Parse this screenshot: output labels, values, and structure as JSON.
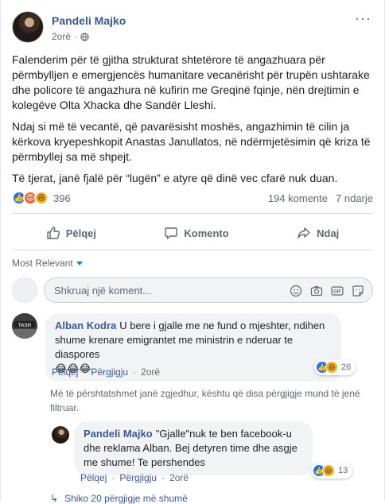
{
  "post": {
    "author": "Pandeli Majko",
    "time": "2orë",
    "paragraphs": [
      "Falenderim për të gjitha strukturat shtetërore të angazhuara për përmbylljen e emergjencës humanitare vecanërisht për trupën ushtarake dhe policore të angazhura në kufirin me Greqinë fqinje, nën drejtimin e kolegëve Olta Xhacka dhe Sandër Lleshi.",
      "Ndaj si më të vecantë, që pavarësisht moshës, angazhimin të cilin ja kërkova kryepeshkopit Anastas Janullatos, në ndërmjetësimin që kriza të përmbyllej sa më shpejt.",
      "Të tjerat, janë fjalë për “lugën” e atyre që dinë vec cfarë nuk duan."
    ]
  },
  "reactions": {
    "count": "396",
    "comments": "194 komente",
    "shares": "7 ndarje"
  },
  "actions": {
    "like": "Pëlqej",
    "comment": "Komento",
    "share": "Ndaj"
  },
  "sort_label": "Most Relevant",
  "composer": {
    "placeholder": "Shkruaj një koment..."
  },
  "comments": [
    {
      "author": "Alban Kodra",
      "text": "U bere i gjalle me ne fund o mjeshter, ndihen shume krenare emigrantet me ministrin e nderuar te diaspores",
      "emoji": "😂😂😂",
      "like_label": "Pëlqej",
      "reply_label": "Përgjigju",
      "time": "2orë",
      "reactions": "26"
    }
  ],
  "filter_note": "Më të përshtatshmet janë zgjedhur, kështu që disa përgjigje mund të jenë filtruar.",
  "reply": {
    "author": "Pandeli Majko",
    "text": "\"Gjalle\"nuk te ben facebook-u dhe reklama Alban. Bej detyren time dhe asgje me shume! Te pershendes",
    "like_label": "Pëlqej",
    "reply_label": "Përgjigju",
    "time": "2orë",
    "reactions": "13"
  },
  "more_replies": "Shiko 20 përgjigje më shumë",
  "colors": {
    "link": "#385898",
    "like_blue": "#1877f2",
    "angry": "#f0612d",
    "haha": "#f7b125",
    "secondary_text": "#606770",
    "bubble": "#f2f3f5"
  }
}
